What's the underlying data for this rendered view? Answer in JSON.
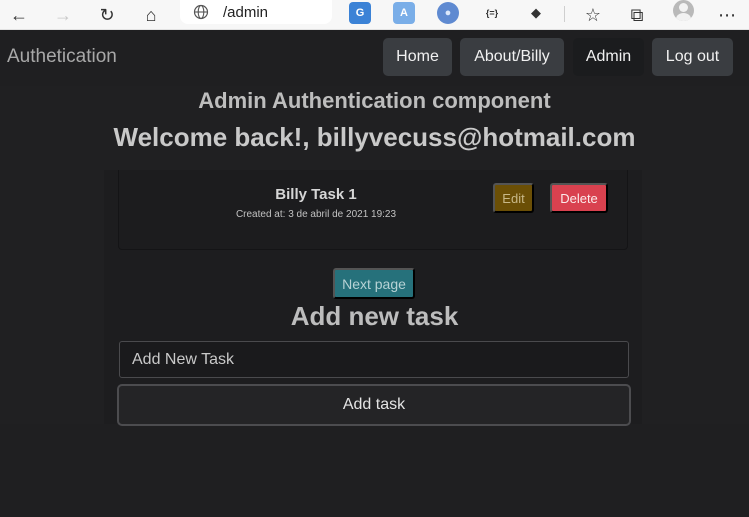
{
  "browser": {
    "url": "/admin",
    "buttons": {
      "back": "←",
      "forward": "→",
      "reload": "↻",
      "home": "⌂",
      "favorites": "☆",
      "collections": "⧉",
      "more": "⋯"
    },
    "extensions": [
      {
        "icon": "translate-icon",
        "glyph": "G",
        "color": "#3b82d6"
      },
      {
        "icon": "translate-alt-icon",
        "glyph": "A",
        "color": "#7aaee8"
      },
      {
        "icon": "edge-circle-icon",
        "glyph": "●",
        "color": "#5f8ad1"
      },
      {
        "icon": "json-icon",
        "glyph": "{=}",
        "color": "#f7f7f7"
      },
      {
        "icon": "ufo-icon",
        "glyph": "◆",
        "color": "#f7f7f7"
      }
    ]
  },
  "navbar": {
    "brand": "Authetication",
    "items": [
      {
        "label": "Home",
        "active": false
      },
      {
        "label": "About/Billy",
        "active": false
      },
      {
        "label": "Admin",
        "active": true
      },
      {
        "label": "Log out",
        "active": false
      }
    ]
  },
  "main": {
    "subtitle": "Admin Authentication component",
    "welcome": "Welcome back!, billyvecuss@hotmail.com",
    "tasks": [
      {
        "title": "Billy Task 1",
        "created": "Created at: 3 de abril de 2021 19:23",
        "edit_label": "Edit",
        "delete_label": "Delete"
      }
    ],
    "next_page_label": "Next page",
    "add_heading": "Add new task",
    "new_task_placeholder": "Add New Task",
    "add_button_label": "Add task"
  },
  "colors": {
    "background": "#1f1f21",
    "nav_button": "#3a3d41",
    "edit": "#6b4f06",
    "delete": "#d9414f",
    "next_page": "#26717b"
  }
}
